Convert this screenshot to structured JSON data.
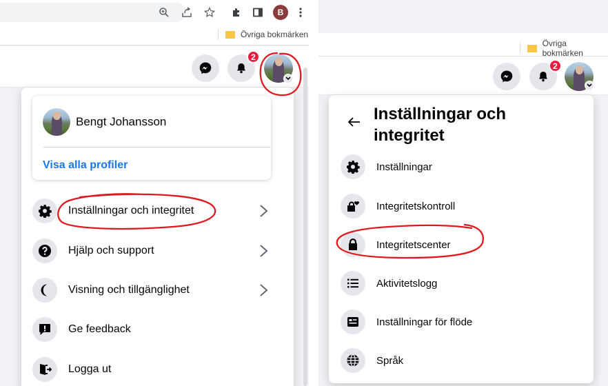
{
  "left": {
    "browser": {
      "profile_initial": "B",
      "bookmark_folder": "Övriga bokmärken"
    },
    "header": {
      "notification_count": "2"
    },
    "profile": {
      "name": "Bengt Johansson",
      "see_all": "Visa alla profiler"
    },
    "menu": [
      {
        "label": "Inställningar och integritet",
        "icon": "gear-icon",
        "has_arrow": true
      },
      {
        "label": "Hjälp och support",
        "icon": "question-icon",
        "has_arrow": true
      },
      {
        "label": "Visning och tillgänglighet",
        "icon": "moon-icon",
        "has_arrow": true
      },
      {
        "label": "Ge feedback",
        "icon": "feedback-icon",
        "has_arrow": false
      },
      {
        "label": "Logga ut",
        "icon": "logout-icon",
        "has_arrow": false
      }
    ]
  },
  "right": {
    "browser": {
      "bookmark_folder": "Övriga bokmärken"
    },
    "header": {
      "notification_count": "2"
    },
    "title_line1": "Inställningar och",
    "title_line2": "integritet",
    "menu": [
      {
        "label": "Inställningar",
        "icon": "gear-icon"
      },
      {
        "label": "Integritetskontroll",
        "icon": "lock-heart-icon"
      },
      {
        "label": "Integritetscenter",
        "icon": "lock-icon"
      },
      {
        "label": "Aktivitetslogg",
        "icon": "list-icon"
      },
      {
        "label": "Inställningar för flöde",
        "icon": "feed-icon"
      },
      {
        "label": "Språk",
        "icon": "globe-icon"
      }
    ]
  },
  "colors": {
    "link_blue": "#1877f2",
    "badge_red": "#e41e3f",
    "annotation_red": "#e0191f"
  }
}
